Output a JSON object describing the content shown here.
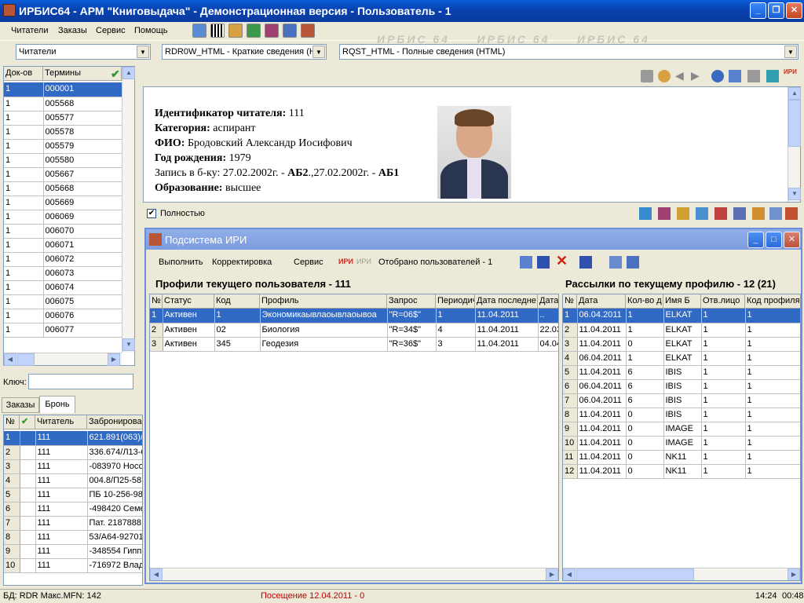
{
  "window": {
    "title": "ИРБИС64 - АРМ \"Книговыдача\" - Демонстрационная версия - Пользователь - 1"
  },
  "menu": [
    "Читатели",
    "Заказы",
    "Сервис",
    "Помощь"
  ],
  "watermark": "ИРБИС 64",
  "combos": {
    "db": "Читатели",
    "brief_format": "RDR0W_HTML - Краткие сведения (H",
    "full_format": "RQST_HTML - Полные сведения (HTML)"
  },
  "left_grid": {
    "headers": [
      "Док-ов",
      "Термины"
    ],
    "rows": [
      [
        "1",
        "000001"
      ],
      [
        "1",
        "005568"
      ],
      [
        "1",
        "005577"
      ],
      [
        "1",
        "005578"
      ],
      [
        "1",
        "005579"
      ],
      [
        "1",
        "005580"
      ],
      [
        "1",
        "005667"
      ],
      [
        "1",
        "005668"
      ],
      [
        "1",
        "005669"
      ],
      [
        "1",
        "006069"
      ],
      [
        "1",
        "006070"
      ],
      [
        "1",
        "006071"
      ],
      [
        "1",
        "006072"
      ],
      [
        "1",
        "006073"
      ],
      [
        "1",
        "006074"
      ],
      [
        "1",
        "006075"
      ],
      [
        "1",
        "006076"
      ],
      [
        "1",
        "006077"
      ]
    ]
  },
  "key_label": "Ключ:",
  "orders": {
    "tabs": [
      "Заказы",
      "Бронь"
    ],
    "headers": [
      "№",
      "✔",
      "Читатель",
      "Забронирован"
    ],
    "rows": [
      [
        "1",
        "",
        "111",
        "621.891(063)/M"
      ],
      [
        "2",
        "",
        "111",
        "336.674/Л13-6"
      ],
      [
        "3",
        "",
        "111",
        "-083970 Носов"
      ],
      [
        "4",
        "",
        "111",
        "004.8/П25-587"
      ],
      [
        "5",
        "",
        "111",
        "ПБ 10-256-98 Г"
      ],
      [
        "6",
        "",
        "111",
        "-498420 Семен"
      ],
      [
        "7",
        "",
        "111",
        "Пат. 2187888"
      ],
      [
        "8",
        "",
        "111",
        "53/А64-927013"
      ],
      [
        "9",
        "",
        "111",
        "-348554 Гиппи"
      ],
      [
        "10",
        "",
        "111",
        "-716972 Влади"
      ]
    ]
  },
  "reader_card": {
    "id_label": "Идентификатор читателя:",
    "id_value": "111",
    "cat_label": "Категория:",
    "cat_value": "аспирант",
    "fio_label": "ФИО:",
    "fio_value": "Бродовский Александр Иосифович",
    "year_label": "Год рождения:",
    "year_value": "1979",
    "rec_prefix": "Запись в б-ку: 27.02.2002г. - ",
    "rec_ab2": "АБ2",
    "rec_mid": ".,27.02.2002г. - ",
    "rec_ab1": "АБ1",
    "edu_label": "Образование:",
    "edu_value": "высшее"
  },
  "fully_label": "Полностью",
  "iri": {
    "title": "Подсистема ИРИ",
    "toolbar": {
      "run": "Выполнить",
      "edit": "Корректировка",
      "service": "Сервис",
      "iri_badge": "ИРИ",
      "selected": "Отобрано пользователей - 1"
    },
    "profiles_title": "Профили текущего пользователя - 111",
    "mailings_title": "Рассылки по текущему профилю - 12 (21)",
    "profiles_headers": [
      "№",
      "Статус",
      "Код",
      "Профиль",
      "Запрос",
      "Периодич",
      "Дата последне",
      "Дата"
    ],
    "profiles_rows": [
      [
        "1",
        "Активен",
        "1",
        "Экономикаывлаоывлаоывоа",
        "\"R=06$\"",
        "1",
        "11.04.2011",
        ".."
      ],
      [
        "2",
        "Активен",
        "02",
        "Биология",
        "\"R=34$\"",
        "4",
        "11.04.2011",
        "22.03"
      ],
      [
        "3",
        "Активен",
        "345",
        "Геодезия",
        "\"R=36$\"",
        "3",
        "11.04.2011",
        "04.04"
      ]
    ],
    "mail_headers": [
      "№",
      "Дата",
      "Кол-во д",
      "Имя Б",
      "Отв.лицо",
      "Код профиля"
    ],
    "mail_rows": [
      [
        "1",
        "06.04.2011",
        "1",
        "ELKAT",
        "1",
        "1"
      ],
      [
        "2",
        "11.04.2011",
        "1",
        "ELKAT",
        "1",
        "1"
      ],
      [
        "3",
        "11.04.2011",
        "0",
        "ELKAT",
        "1",
        "1"
      ],
      [
        "4",
        "06.04.2011",
        "1",
        "ELKAT",
        "1",
        "1"
      ],
      [
        "5",
        "11.04.2011",
        "6",
        "IBIS",
        "1",
        "1"
      ],
      [
        "6",
        "06.04.2011",
        "6",
        "IBIS",
        "1",
        "1"
      ],
      [
        "7",
        "06.04.2011",
        "6",
        "IBIS",
        "1",
        "1"
      ],
      [
        "8",
        "11.04.2011",
        "0",
        "IBIS",
        "1",
        "1"
      ],
      [
        "9",
        "11.04.2011",
        "0",
        "IMAGE",
        "1",
        "1"
      ],
      [
        "10",
        "11.04.2011",
        "0",
        "IMAGE",
        "1",
        "1"
      ],
      [
        "11",
        "11.04.2011",
        "0",
        "NK11",
        "1",
        "1"
      ],
      [
        "12",
        "11.04.2011",
        "0",
        "NK11",
        "1",
        "1"
      ]
    ]
  },
  "status": {
    "db": "БД: RDR Макс.MFN: 142",
    "visit": "Посещение 12.04.2011 - 0",
    "time": "14:24",
    "elapsed": "00:48"
  }
}
